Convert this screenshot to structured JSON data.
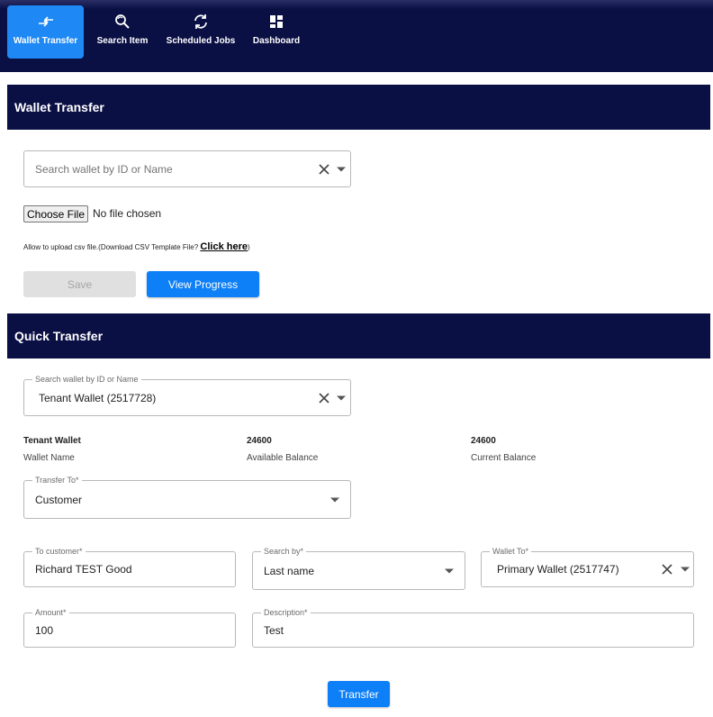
{
  "nav": {
    "items": [
      {
        "label": "Wallet Transfer",
        "icon": "transfer-arrows-icon",
        "active": true
      },
      {
        "label": "Search Item",
        "icon": "search-refresh-icon",
        "active": false
      },
      {
        "label": "Scheduled Jobs",
        "icon": "sync-icon",
        "active": false
      },
      {
        "label": "Dashboard",
        "icon": "dashboard-grid-icon",
        "active": false
      }
    ]
  },
  "wallet_transfer": {
    "title": "Wallet Transfer",
    "search_placeholder": "Search wallet by ID or Name",
    "file_button": "Choose File",
    "file_status": "No file chosen",
    "hint_text": "Allow to upload csv file.(Download CSV Template File?",
    "hint_link": "Click here",
    "hint_close": ")",
    "save_label": "Save",
    "progress_label": "View Progress"
  },
  "quick_transfer": {
    "title": "Quick Transfer",
    "search_legend": "Search wallet by ID or Name",
    "search_value": "Tenant Wallet (2517728)",
    "wallet_name_value": "Tenant Wallet",
    "wallet_name_label": "Wallet Name",
    "available_value": "24600",
    "available_label": "Available Balance",
    "current_value": "24600",
    "current_label": "Current Balance",
    "transfer_to_legend": "Transfer To*",
    "transfer_to_value": "Customer",
    "to_customer_legend": "To customer*",
    "to_customer_value": "Richard TEST Good",
    "search_by_legend": "Search by*",
    "search_by_value": "Last name",
    "wallet_to_legend": "Wallet To*",
    "wallet_to_value": "Primary Wallet (2517747)",
    "amount_legend": "Amount*",
    "amount_value": "100",
    "description_legend": "Description*",
    "description_value": "Test",
    "transfer_label": "Transfer"
  },
  "colors": {
    "navy": "#0a0f44",
    "accent": "#0d7ff7",
    "active_tab": "#1e88f5"
  }
}
